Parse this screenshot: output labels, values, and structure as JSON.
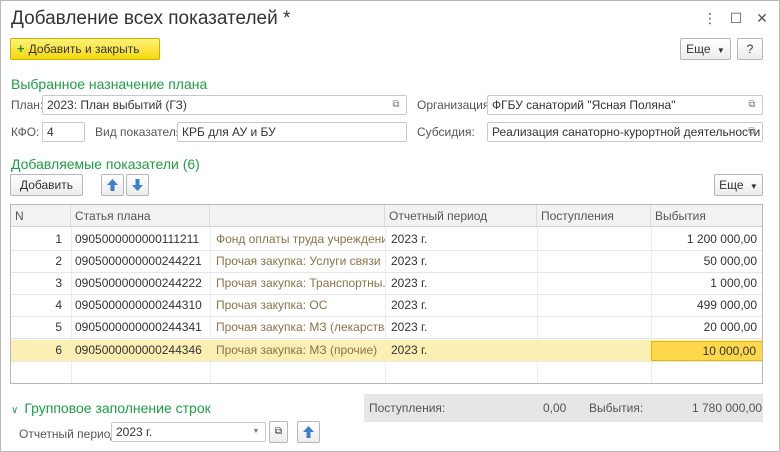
{
  "window": {
    "title": "Добавление всех показателей *",
    "menu_icon": "⋮",
    "maximize_icon": "☐",
    "close_icon": "✕"
  },
  "toolbar": {
    "add_close_label": "Добавить и закрыть",
    "more_label": "Еще",
    "help_label": "?"
  },
  "plan_section": {
    "title": "Выбранное назначение плана",
    "plan_label": "План:",
    "plan_value": "2023: План выбытий (ГЗ)",
    "org_label": "Организация:",
    "org_value": "ФГБУ санаторий \"Ясная Поляна\"",
    "kfo_label": "КФО:",
    "kfo_value": "4",
    "indicator_type_label": "Вид показателя:",
    "indicator_type_value": "КРБ для АУ и БУ",
    "subsidy_label": "Субсидия:",
    "subsidy_value": "Реализация санаторно-курортной деятельности"
  },
  "indicators_section": {
    "title": "Добавляемые показатели (6)",
    "add_label": "Добавить",
    "more_label": "Еще"
  },
  "table": {
    "columns": [
      "N",
      "Статья плана",
      "",
      "Отчетный период",
      "Поступления",
      "Выбытия"
    ],
    "rows": [
      {
        "n": "1",
        "code": "0905000000000111211",
        "name": "Фонд оплаты труда учреждений",
        "period": "2023 г.",
        "income": "",
        "outflow": "1 200 000,00"
      },
      {
        "n": "2",
        "code": "0905000000000244221",
        "name": "Прочая закупка: Услуги связи",
        "period": "2023 г.",
        "income": "",
        "outflow": "50 000,00"
      },
      {
        "n": "3",
        "code": "0905000000000244222",
        "name": "Прочая закупка: Транспортны...",
        "period": "2023 г.",
        "income": "",
        "outflow": "1 000,00"
      },
      {
        "n": "4",
        "code": "0905000000000244310",
        "name": "Прочая закупка: ОС",
        "period": "2023 г.",
        "income": "",
        "outflow": "499 000,00"
      },
      {
        "n": "5",
        "code": "0905000000000244341",
        "name": "Прочая закупка: МЗ (лекарства)",
        "period": "2023 г.",
        "income": "",
        "outflow": "20 000,00"
      },
      {
        "n": "6",
        "code": "0905000000000244346",
        "name": "Прочая закупка: МЗ (прочие)",
        "period": "2023 г.",
        "income": "",
        "outflow": "10 000,00"
      }
    ]
  },
  "totals": {
    "income_label": "Поступления:",
    "income_value": "0,00",
    "outflow_label": "Выбытия:",
    "outflow_value": "1 780 000,00"
  },
  "group_fill": {
    "title": "Групповое заполнение строк",
    "period_label": "Отчетный период:",
    "period_value": "2023 г."
  },
  "colors": {
    "accent_green": "#1f9e45",
    "selected_row": "#fbefb4",
    "yellow_button": "#f5d90c"
  }
}
